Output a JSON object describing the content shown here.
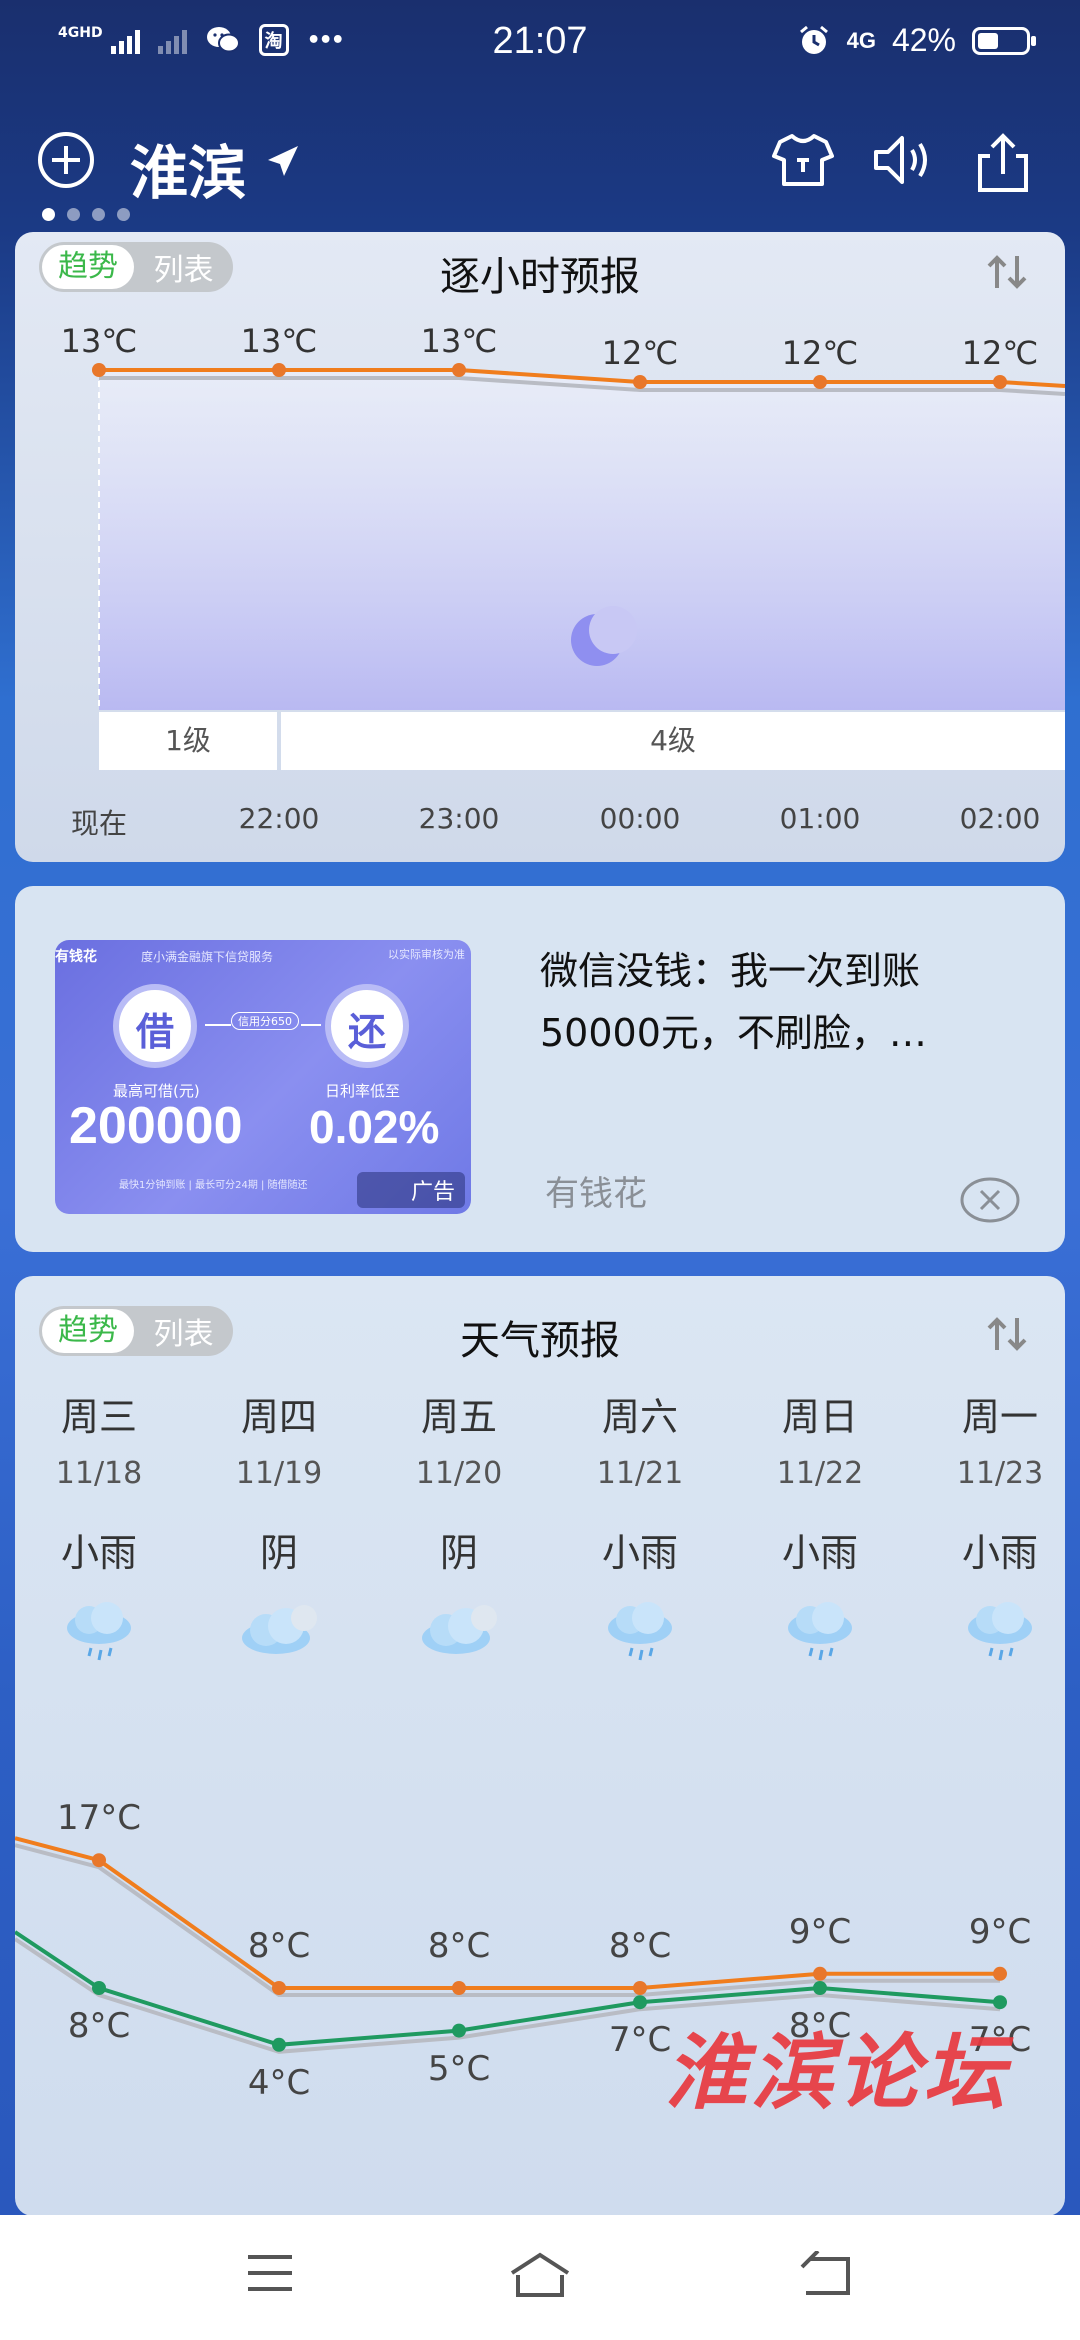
{
  "status_bar": {
    "network_left": "4GHD",
    "app_badge": "淘",
    "more": "•••",
    "time": "21:07",
    "network_right": "4G",
    "battery": "42%"
  },
  "header": {
    "city": "淮滨",
    "pages": 4,
    "active_page": 0
  },
  "hourly": {
    "toggle_on": "趋势",
    "toggle_off": "列表",
    "title": "逐小时预报",
    "temps": [
      "13℃",
      "13℃",
      "13℃",
      "12℃",
      "12℃",
      "12℃"
    ],
    "temp_values": [
      13,
      13,
      13,
      12,
      12,
      12
    ],
    "times": [
      "现在",
      "22:00",
      "23:00",
      "00:00",
      "01:00",
      "02:00"
    ],
    "wind": [
      "1级",
      "4级"
    ],
    "icon": "moon-icon"
  },
  "ad": {
    "image": {
      "brand": "有钱花",
      "service": "度小满金融旗下信贷服务",
      "notice": "以实际审核为准",
      "borrow": "借",
      "repay": "还",
      "credit": "信用分650",
      "max_label": "最高可借(元)",
      "max_value": "200000",
      "rate_label": "日利率低至",
      "rate_value": "0.02%",
      "footer": "最快1分钟到账  |  最长可分24期  |  随借随还",
      "badge": "广告"
    },
    "text": "微信没钱：我一次到账50000元，不刷脸，…",
    "source": "有钱花"
  },
  "forecast": {
    "toggle_on": "趋势",
    "toggle_off": "列表",
    "title": "天气预报",
    "days": [
      {
        "day": "周三",
        "date": "11/18",
        "cond": "小雨",
        "icon": "light-rain-icon",
        "high": "17°C",
        "low": "8°C"
      },
      {
        "day": "周四",
        "date": "11/19",
        "cond": "阴",
        "icon": "overcast-icon",
        "high": "8°C",
        "low": "4°C"
      },
      {
        "day": "周五",
        "date": "11/20",
        "cond": "阴",
        "icon": "overcast-icon",
        "high": "8°C",
        "low": "5°C"
      },
      {
        "day": "周六",
        "date": "11/21",
        "cond": "小雨",
        "icon": "light-rain-icon",
        "high": "8°C",
        "low": "7°C"
      },
      {
        "day": "周日",
        "date": "11/22",
        "cond": "小雨",
        "icon": "light-rain-icon",
        "high": "9°C",
        "low": "8°C"
      },
      {
        "day": "周一",
        "date": "11/23",
        "cond": "小雨",
        "icon": "light-rain-icon",
        "high": "9°C",
        "low": "7°C"
      }
    ],
    "highs": [
      17,
      8,
      8,
      8,
      9,
      9
    ],
    "lows": [
      8,
      4,
      5,
      7,
      8,
      7
    ]
  },
  "watermark": "淮滨论坛",
  "colors": {
    "high_line": "#f07d1d",
    "low_line": "#1f9a60",
    "toggle_active": "#3bb84a"
  }
}
